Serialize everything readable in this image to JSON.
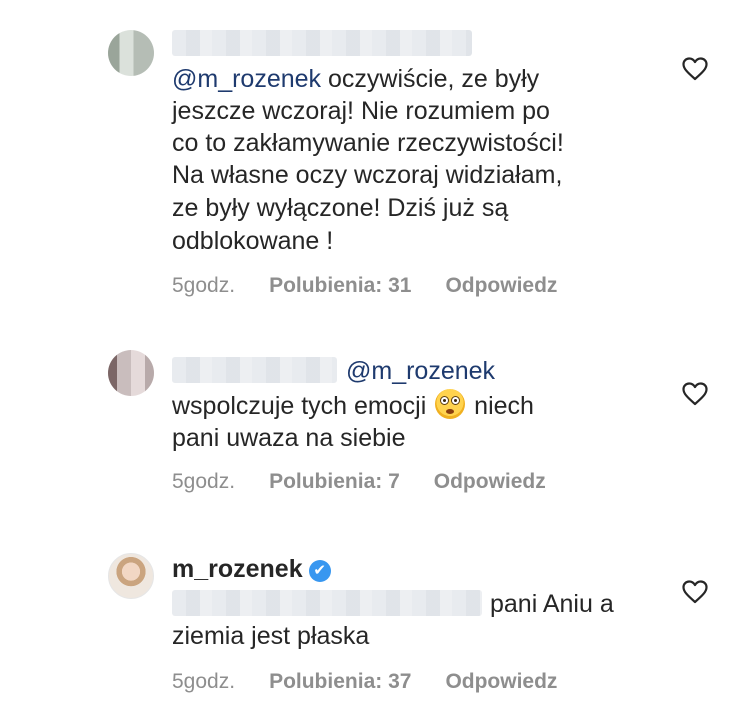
{
  "comments": [
    {
      "mention": "@m_rozenek",
      "lines": [
        " oczywiście, ze były",
        "jeszcze wczoraj! Nie rozumiem po",
        "co to zakłamywanie rzeczywistości!",
        "Na własne oczy wczoraj widziałam,",
        "ze były wyłączone! Dziś już są",
        "odblokowane !"
      ],
      "time": "5godz.",
      "likes": "Polubienia: 31",
      "reply": "Odpowiedz"
    },
    {
      "mention": "@m_rozenek",
      "line1_before_emoji": "wspolczuje tych emocji ",
      "line1_after_emoji": "niech",
      "line2": "pani uwaza na siebie",
      "time": "5godz.",
      "likes": "Polubienia: 7",
      "reply": "Odpowiedz"
    },
    {
      "username": "m_rozenek",
      "verified_icon": "✔",
      "line1": "pani Aniu a",
      "line2": "ziemia jest płaska",
      "time": "5godz.",
      "likes": "Polubienia: 37",
      "reply": "Odpowiedz"
    }
  ],
  "icons": {
    "like": "heart-outline-icon",
    "verified": "verified-badge-icon",
    "emoji": "flushed-face-emoji"
  },
  "colors": {
    "text": "#262626",
    "meta": "#8e8e8e",
    "mention": "#1e3a6e",
    "verified": "#3897f0"
  }
}
